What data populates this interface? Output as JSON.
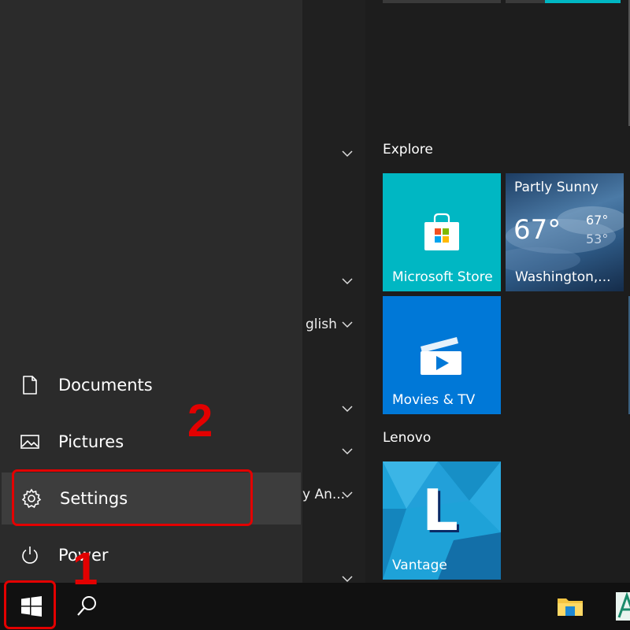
{
  "start_menu": {
    "places": [
      {
        "label": "Documents",
        "icon": "document-icon"
      },
      {
        "label": "Pictures",
        "icon": "pictures-icon"
      },
      {
        "label": "Settings",
        "icon": "gear-icon"
      },
      {
        "label": "Power",
        "icon": "power-icon"
      }
    ],
    "app_list_fragments": [
      "glish",
      "y An..."
    ]
  },
  "tiles": {
    "groups": [
      {
        "title": "Explore"
      },
      {
        "title": "Lenovo"
      }
    ],
    "store": {
      "label": "Microsoft Store",
      "color": "#00b7c3"
    },
    "weather": {
      "condition": "Partly Sunny",
      "temp": "67°",
      "high": "67°",
      "low": "53°",
      "location": "Washington,..."
    },
    "movies": {
      "label": "Movies & TV",
      "color": "#0078d7"
    },
    "vantage": {
      "label": "Vantage",
      "letter": "L"
    }
  },
  "annotations": {
    "step1": "1",
    "step2": "2",
    "color": "#e30000"
  }
}
